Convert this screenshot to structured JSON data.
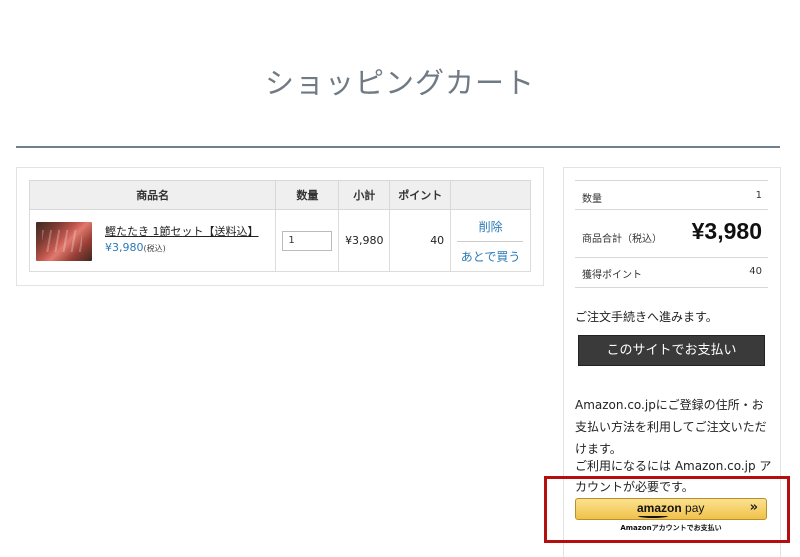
{
  "page": {
    "title": "ショッピングカート"
  },
  "cart": {
    "headers": {
      "name": "商品名",
      "qty": "数量",
      "subtotal": "小計",
      "points": "ポイント",
      "action": ""
    },
    "items": [
      {
        "name": "鰹たたき 1節セット【送料込】",
        "price": "¥3,980",
        "tax_note": "(税込)",
        "qty": "1",
        "subtotal": "¥3,980",
        "points": "40",
        "delete_label": "削除",
        "later_label": "あとで買う"
      }
    ]
  },
  "summary": {
    "count_label": "数量",
    "count_value": "1",
    "total_label": "商品合計（税込）",
    "total_value": "¥3,980",
    "points_label": "獲得ポイント",
    "points_value": "40",
    "proceed_text": "ご注文手続きへ進みます。",
    "site_pay_button": "このサイトでお支払い",
    "amazon_text": "Amazon.co.jpにご登録の住所・お支払い方法を利用してご注文いただけます。",
    "amazon_text2": "ご利用になるには Amazon.co.jp アカウントが必要です。",
    "amazon_pay_brand": "amazon",
    "amazon_pay_word": "pay",
    "amazon_pay_chevron": "»",
    "amazon_pay_caption": "Amazonアカウントでお支払い"
  },
  "colors": {
    "accent": "#2a7ab8",
    "highlight": "#b30f0f",
    "amazon_button": "#f0c14b",
    "dark_button": "#3a3a3a"
  },
  "icons": {
    "product_image": "bonito-tataki-photo",
    "amazon_chevron": "double-chevron-right-icon"
  }
}
